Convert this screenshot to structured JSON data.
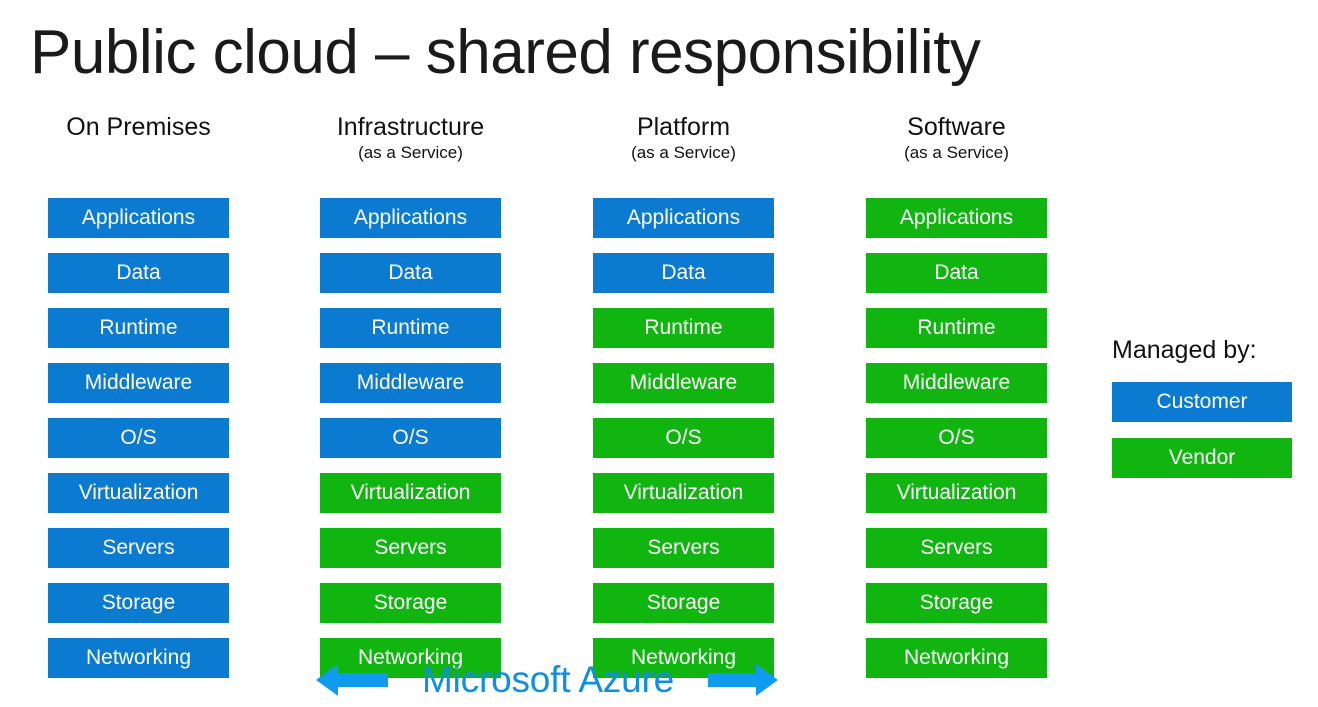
{
  "title": "Public cloud – shared responsibility",
  "colors": {
    "customer_blue": "#0B7AD1",
    "vendor_green": "#10B510",
    "azure_blue": "#0F8FE0",
    "arrow_blue": "#0F9CF0",
    "text_dark": "#111111",
    "background": "#FFFFFF"
  },
  "columns": [
    {
      "header": "On Premises",
      "subheader": "",
      "layers": [
        {
          "label": "Applications",
          "managed_by": "Customer"
        },
        {
          "label": "Data",
          "managed_by": "Customer"
        },
        {
          "label": "Runtime",
          "managed_by": "Customer"
        },
        {
          "label": "Middleware",
          "managed_by": "Customer"
        },
        {
          "label": "O/S",
          "managed_by": "Customer"
        },
        {
          "label": "Virtualization",
          "managed_by": "Customer"
        },
        {
          "label": "Servers",
          "managed_by": "Customer"
        },
        {
          "label": "Storage",
          "managed_by": "Customer"
        },
        {
          "label": "Networking",
          "managed_by": "Customer"
        }
      ]
    },
    {
      "header": "Infrastructure",
      "subheader": "(as a Service)",
      "layers": [
        {
          "label": "Applications",
          "managed_by": "Customer"
        },
        {
          "label": "Data",
          "managed_by": "Customer"
        },
        {
          "label": "Runtime",
          "managed_by": "Customer"
        },
        {
          "label": "Middleware",
          "managed_by": "Customer"
        },
        {
          "label": "O/S",
          "managed_by": "Customer"
        },
        {
          "label": "Virtualization",
          "managed_by": "Vendor"
        },
        {
          "label": "Servers",
          "managed_by": "Vendor"
        },
        {
          "label": "Storage",
          "managed_by": "Vendor"
        },
        {
          "label": "Networking",
          "managed_by": "Vendor"
        }
      ]
    },
    {
      "header": "Platform",
      "subheader": "(as a Service)",
      "layers": [
        {
          "label": "Applications",
          "managed_by": "Customer"
        },
        {
          "label": "Data",
          "managed_by": "Customer"
        },
        {
          "label": "Runtime",
          "managed_by": "Vendor"
        },
        {
          "label": "Middleware",
          "managed_by": "Vendor"
        },
        {
          "label": "O/S",
          "managed_by": "Vendor"
        },
        {
          "label": "Virtualization",
          "managed_by": "Vendor"
        },
        {
          "label": "Servers",
          "managed_by": "Vendor"
        },
        {
          "label": "Storage",
          "managed_by": "Vendor"
        },
        {
          "label": "Networking",
          "managed_by": "Vendor"
        }
      ]
    },
    {
      "header": "Software",
      "subheader": "(as a Service)",
      "layers": [
        {
          "label": "Applications",
          "managed_by": "Vendor"
        },
        {
          "label": "Data",
          "managed_by": "Vendor"
        },
        {
          "label": "Runtime",
          "managed_by": "Vendor"
        },
        {
          "label": "Middleware",
          "managed_by": "Vendor"
        },
        {
          "label": "O/S",
          "managed_by": "Vendor"
        },
        {
          "label": "Virtualization",
          "managed_by": "Vendor"
        },
        {
          "label": "Servers",
          "managed_by": "Vendor"
        },
        {
          "label": "Storage",
          "managed_by": "Vendor"
        },
        {
          "label": "Networking",
          "managed_by": "Vendor"
        }
      ]
    }
  ],
  "legend": {
    "title": "Managed by:",
    "entries": [
      {
        "label": "Customer",
        "swatch": "customer"
      },
      {
        "label": "Vendor",
        "swatch": "vendor"
      }
    ]
  },
  "banner": {
    "left_arrow_icon": "arrow-left-icon",
    "wordmark": "Microsoft Azure",
    "right_arrow_icon": "arrow-right-icon"
  }
}
